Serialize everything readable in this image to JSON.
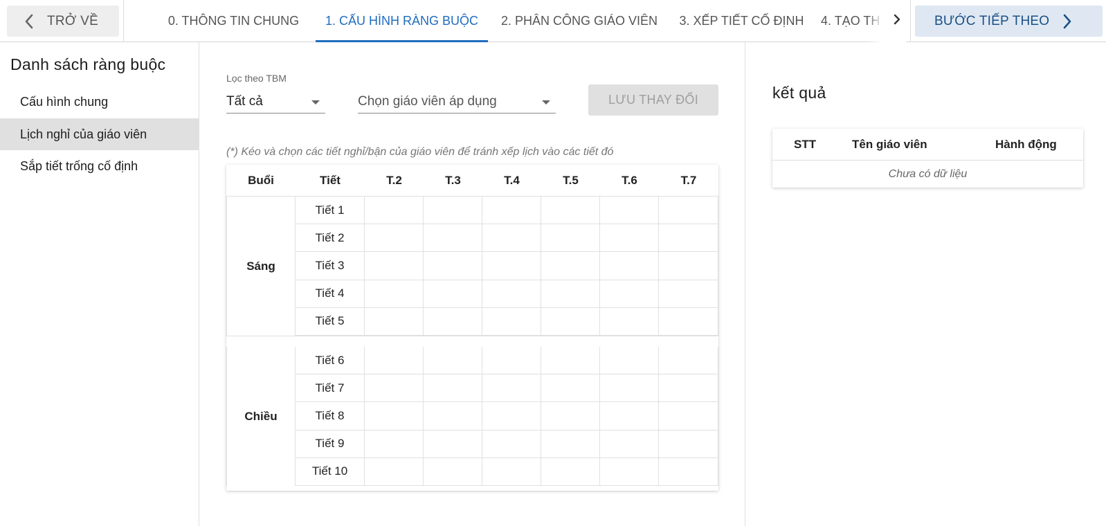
{
  "topbar": {
    "back_label": "TRỞ VỀ",
    "back_icon": "chevron-left-icon",
    "tabs": [
      {
        "label": "0. THÔNG TIN CHUNG",
        "active": false
      },
      {
        "label": "1. CẤU HÌNH RÀNG BUỘC",
        "active": true
      },
      {
        "label": "2. PHÂN CÔNG GIÁO VIÊN",
        "active": false
      },
      {
        "label": "3. XẾP TIẾT CỐ ĐỊNH",
        "active": false
      },
      {
        "label": "4. TẠO TH",
        "active": false
      }
    ],
    "tabs_next_icon": "chevron-right-icon",
    "next_step_label": "BƯỚC TIẾP THEO",
    "next_step_icon": "chevron-right-icon",
    "accent_color": "#1f6cbf"
  },
  "sidebar": {
    "title": "Danh sách ràng buộc",
    "items": [
      {
        "label": "Cấu hình chung",
        "active": false
      },
      {
        "label": "Lịch nghỉ của giáo viên",
        "active": true
      },
      {
        "label": "Sắp tiết trống cố định",
        "active": false
      }
    ]
  },
  "filters": {
    "tbm_label": "Lọc theo TBM",
    "tbm_value": "Tất cả",
    "teacher_placeholder": "Chọn giáo viên áp dụng",
    "save_label": "LƯU THAY ĐỔI"
  },
  "schedule": {
    "hint": "(*) Kéo và chọn các tiết nghỉ/bận của giáo viên để tránh xếp lịch vào các tiết đó",
    "headers": {
      "session": "Buổi",
      "period": "Tiết",
      "days": [
        "T.2",
        "T.3",
        "T.4",
        "T.5",
        "T.6",
        "T.7"
      ]
    },
    "sessions": [
      {
        "name": "Sáng",
        "periods": [
          "Tiết 1",
          "Tiết 2",
          "Tiết 3",
          "Tiết 4",
          "Tiết 5"
        ]
      },
      {
        "name": "Chiều",
        "periods": [
          "Tiết 6",
          "Tiết 7",
          "Tiết 8",
          "Tiết 9",
          "Tiết 10"
        ]
      }
    ]
  },
  "results": {
    "title": "kết quả",
    "columns": [
      "STT",
      "Tên giáo viên",
      "Hành động"
    ],
    "empty_text": "Chưa có dữ liệu"
  }
}
